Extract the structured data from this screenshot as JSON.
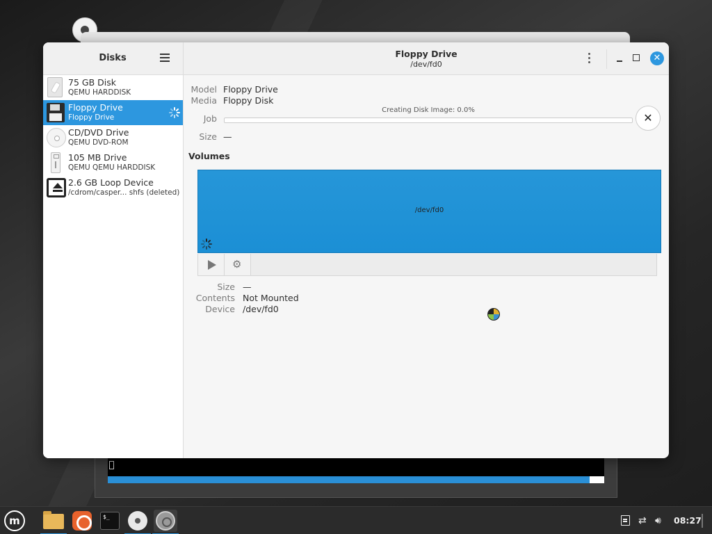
{
  "sidebar": {
    "title": "Disks",
    "items": [
      {
        "name": "75 GB Disk",
        "sub": "QEMU HARDDISK",
        "icon": "harddisk-icon"
      },
      {
        "name": "Floppy Drive",
        "sub": "Floppy Drive",
        "icon": "floppy-icon",
        "selected": true
      },
      {
        "name": "CD/DVD Drive",
        "sub": "QEMU DVD-ROM",
        "icon": "optical-disc-icon"
      },
      {
        "name": "105 MB Drive",
        "sub": "QEMU QEMU HARDDISK",
        "icon": "usb-drive-icon"
      },
      {
        "name": "2.6 GB Loop Device",
        "sub": "/cdrom/casper... shfs (deleted)",
        "icon": "eject-icon"
      }
    ]
  },
  "header": {
    "title": "Floppy Drive",
    "subtitle": "/dev/fd0"
  },
  "drive": {
    "model_label": "Model",
    "model_value": "Floppy Drive",
    "media_label": "Media",
    "media_value": "Floppy Disk",
    "job_label": "Job",
    "job_caption": "Creating Disk Image: 0.0%",
    "job_progress": 0.0,
    "size_label": "Size",
    "size_value": "—"
  },
  "volumes": {
    "heading": "Volumes",
    "block_label": "/dev/fd0",
    "size_label": "Size",
    "size_value": "—",
    "contents_label": "Contents",
    "contents_value": "Not Mounted",
    "device_label": "Device",
    "device_value": "/dev/fd0"
  },
  "background_window": {
    "terminal_progress": 0.97
  },
  "taskbar": {
    "clock": "08:27",
    "apps": [
      "menu-icon",
      "files-icon",
      "firefox-icon",
      "terminal-icon",
      "disc-icon",
      "disks-icon"
    ],
    "terminal_glyph": "$_"
  },
  "colors": {
    "accent": "#2d97df",
    "volume": "#1b8fd5",
    "taskbar": "#2b2b2b"
  }
}
